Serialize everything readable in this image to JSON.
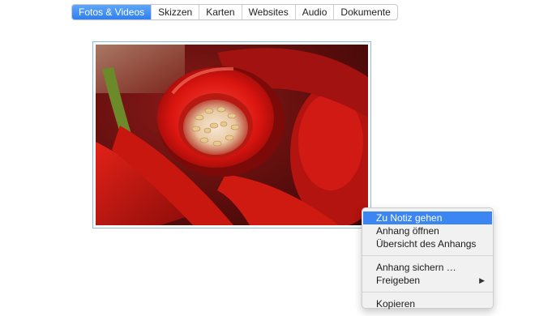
{
  "tabs": [
    {
      "label": "Fotos & Videos",
      "active": true
    },
    {
      "label": "Skizzen",
      "active": false
    },
    {
      "label": "Karten",
      "active": false
    },
    {
      "label": "Websites",
      "active": false
    },
    {
      "label": "Audio",
      "active": false
    },
    {
      "label": "Dokumente",
      "active": false
    }
  ],
  "attachment": {
    "image": "red-chili-pepper-photo",
    "selected": true
  },
  "context_menu": {
    "items": {
      "go_to_note": "Zu Notiz gehen",
      "open_attachment": "Anhang öffnen",
      "attachment_overview": "Übersicht des Anhangs",
      "save_attachment": "Anhang sichern …",
      "share": "Freigeben",
      "copy": "Kopieren"
    },
    "highlighted_item": "go_to_note",
    "submenu_arrow_icon": "triangle-right-icon"
  },
  "colors": {
    "accent": "#3b86f2",
    "selection_border": "#8fb8ea"
  }
}
